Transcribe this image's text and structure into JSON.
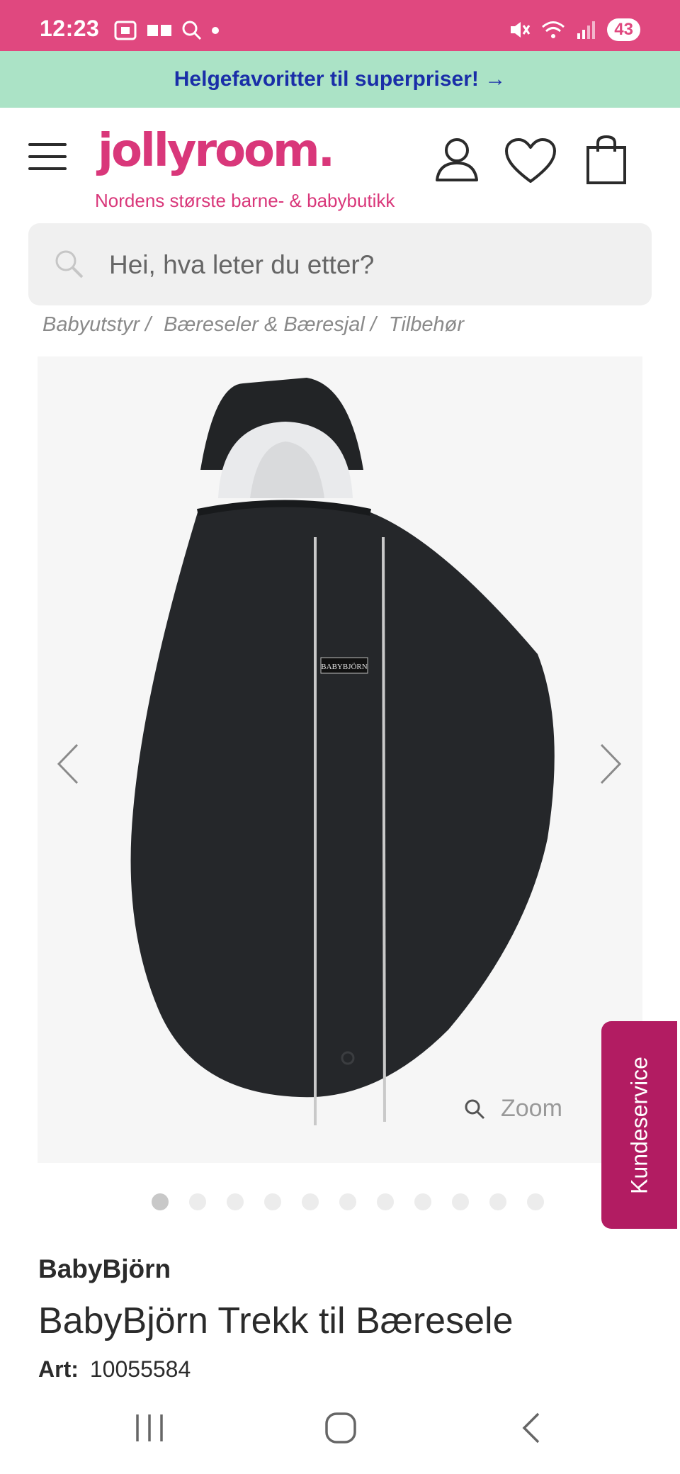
{
  "status_bar": {
    "time": "12:23",
    "battery": "43"
  },
  "promo": {
    "text": "Helgefavoritter til superpriser! →"
  },
  "header": {
    "logo": "jollyroom.",
    "tagline": "Nordens største barne- & babybutikk"
  },
  "search": {
    "placeholder": "Hei, hva leter du etter?"
  },
  "breadcrumb": [
    "Babyutstyr /",
    "Bæreseler & Bæresjal /",
    "Tilbehør"
  ],
  "gallery": {
    "zoom_label": "Zoom",
    "label_on_product": "BABYBJÖRN",
    "dot_count": 11,
    "active_dot": 1
  },
  "kundeservice": {
    "label": "Kundeservice"
  },
  "product": {
    "brand": "BabyBjörn",
    "title": "BabyBjörn Trekk til Bæresele",
    "art_label": "Art:",
    "art_number": "10055584"
  },
  "colors": {
    "status": "#e0487f",
    "promo_bg": "#abe3c6",
    "brand_pink": "#d9377a",
    "kunde_bg": "#b21c62"
  }
}
